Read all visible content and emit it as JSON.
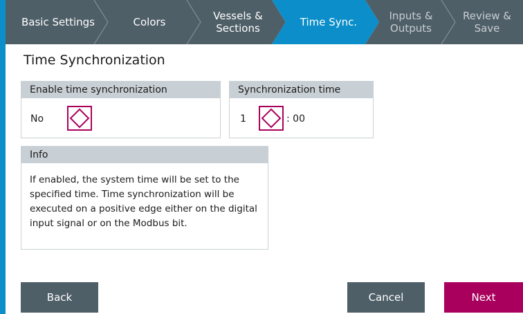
{
  "wizard": {
    "steps": [
      {
        "label": "Basic Settings",
        "state": "done"
      },
      {
        "label": "Colors",
        "state": "done"
      },
      {
        "label": "Vessels &\nSections",
        "state": "done"
      },
      {
        "label": "Time Sync.",
        "state": "active"
      },
      {
        "label": "Inputs &\nOutputs",
        "state": "future"
      },
      {
        "label": "Review &\nSave",
        "state": "future"
      }
    ]
  },
  "page": {
    "title": "Time Synchronization"
  },
  "enable_sync": {
    "header": "Enable time synchronization",
    "value": "No"
  },
  "sync_time": {
    "header": "Synchronization time",
    "hour": "1",
    "minutes_suffix": ": 00"
  },
  "info": {
    "header": "Info",
    "text": "If enabled, the system time will be set to the specified time. Time synchronization will be executed on a positive edge either on the digital input signal or on the Modbus bit."
  },
  "buttons": {
    "back": "Back",
    "cancel": "Cancel",
    "next": "Next"
  },
  "colors": {
    "accent_blue": "#0b8ec9",
    "nav_gray": "#4f5f68",
    "stepper_magenta": "#a8005c",
    "next_button": "#a8005c"
  }
}
